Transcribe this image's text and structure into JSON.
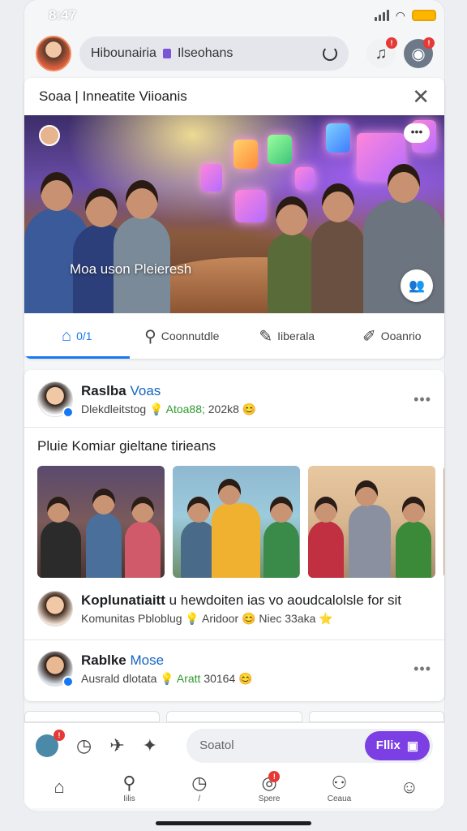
{
  "status": {
    "time": "8:47"
  },
  "header": {
    "search_text": "Hibounairia",
    "search_suffix": "Ilseohans"
  },
  "top_card": {
    "title": "Soaa | Inneatite Viioanis",
    "overlay_text": "Moa uson Pleieresh",
    "tabs": [
      {
        "label": "0/1"
      },
      {
        "label": "Coonnutdle"
      },
      {
        "label": "Iiberala"
      },
      {
        "label": "Ooanrio"
      }
    ]
  },
  "feed": {
    "post1": {
      "name": "Raslba",
      "name_accent": "Voas",
      "meta_a": "Dlekdleitstog",
      "meta_b": "Atoa88;",
      "meta_c": "202k8",
      "caption": "Pluie Komiar gieltane tirieans"
    },
    "post2": {
      "name": "Koplunatiaitt",
      "name_tail": "u hewdoiten ias vo aoudcalolsle for sit",
      "sub": "Komunitas Pbloblug",
      "sub_b": "Aridoor",
      "sub_c": "Niec 33aka"
    },
    "post3": {
      "name": "Rablke",
      "name_accent": "Mose",
      "meta_a": "Ausrald dlotata",
      "meta_b": "Aratt",
      "meta_c": "30164"
    }
  },
  "composer": {
    "placeholder": "Soatol",
    "send_label": "Fllix"
  },
  "bottom_nav": [
    {
      "label": ""
    },
    {
      "label": "Iilis"
    },
    {
      "label": "/"
    },
    {
      "label": "Spere"
    },
    {
      "label": "Ceaua"
    },
    {
      "label": ""
    }
  ],
  "colors": {
    "accent": "#1877f2",
    "purple": "#7b3fe4",
    "badge": "#e53935"
  }
}
